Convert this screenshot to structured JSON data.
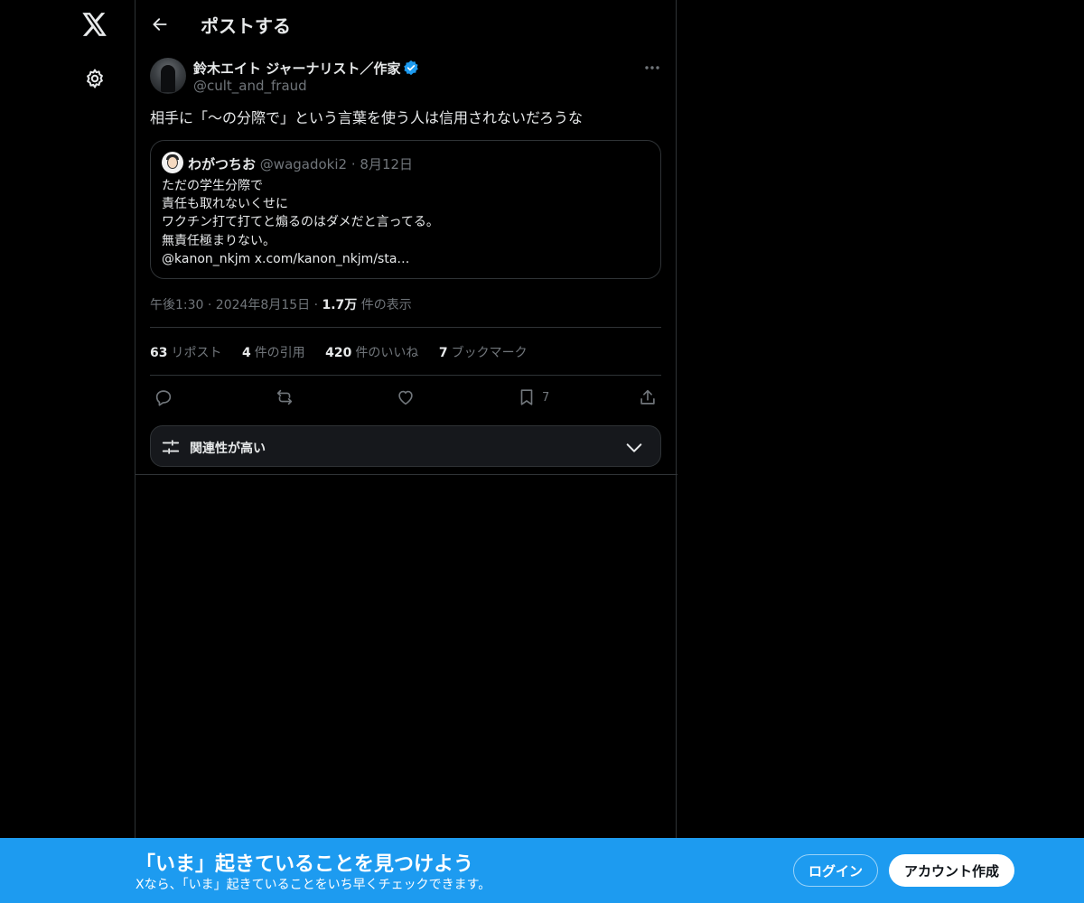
{
  "header": {
    "title": "ポストする"
  },
  "tweet": {
    "author_name": "鈴木エイト ジャーナリスト／作家",
    "author_handle": "@cult_and_fraud",
    "text": "相手に「〜の分際で」という言葉を使う人は信用されないだろうな",
    "timestamp": "午後1:30 · 2024年8月15日 ·",
    "views_count": "1.7万",
    "views_label": "件の表示"
  },
  "quote": {
    "name": "わがつちお",
    "handle": "@wagadoki2",
    "dot": "·",
    "date": "8月12日",
    "lines": [
      "ただの学生分際で",
      "責任も取れないくせに",
      "ワクチン打て打てと煽るのはダメだと言ってる。",
      "無責任極まりない。",
      "@kanon_nkjm x.com/kanon_nkjm/sta…"
    ]
  },
  "stats": [
    {
      "num": "63",
      "label": "リポスト"
    },
    {
      "num": "4",
      "label": "件の引用"
    },
    {
      "num": "420",
      "label": "件のいいね"
    },
    {
      "num": "7",
      "label": "ブックマーク"
    }
  ],
  "actions": {
    "bookmark_count": "7"
  },
  "sort": {
    "label": "関連性が高い"
  },
  "banner": {
    "title": "「いま」起きていることを見つけよう",
    "subtitle": "Xなら、「いま」起きていることをいち早くチェックできます。",
    "login_label": "ログイン",
    "signup_label": "アカウント作成"
  },
  "colors": {
    "accent": "#1d9bf0",
    "verified": "#1d9bf0",
    "muted": "#71767b",
    "border": "#2f3336"
  }
}
